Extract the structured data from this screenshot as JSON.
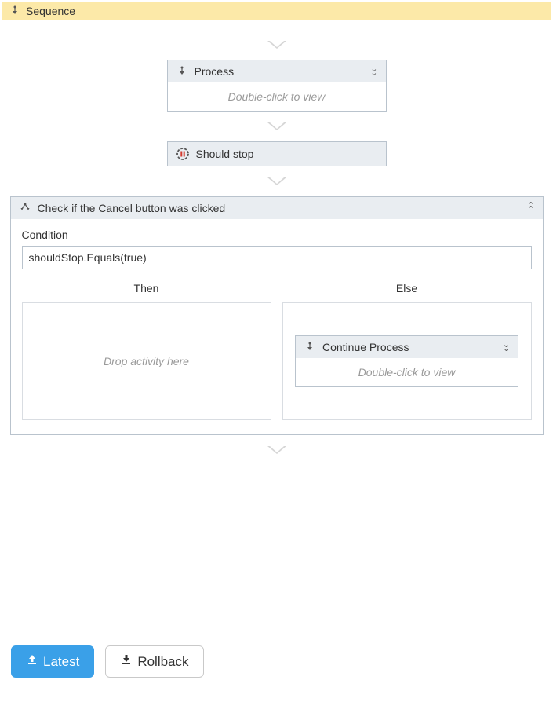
{
  "sequence": {
    "title": "Sequence"
  },
  "process": {
    "title": "Process",
    "hint": "Double-click to view"
  },
  "shouldStop": {
    "title": "Should stop"
  },
  "ifActivity": {
    "title": "Check if the Cancel button was clicked",
    "condition_label": "Condition",
    "condition_value": "shouldStop.Equals(true)",
    "then_label": "Then",
    "else_label": "Else",
    "then_hint": "Drop activity here"
  },
  "continueProcess": {
    "title": "Continue Process",
    "hint": "Double-click to view"
  },
  "buttons": {
    "latest": "Latest",
    "rollback": "Rollback"
  }
}
